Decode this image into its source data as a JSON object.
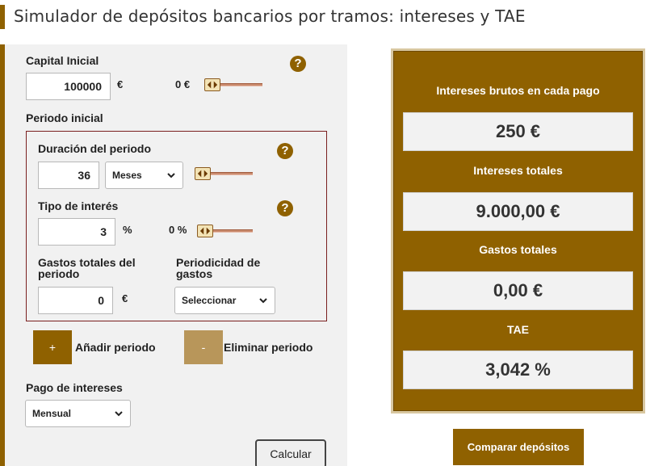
{
  "header": {
    "title": "Simulador de depósitos bancarios por tramos: intereses y TAE"
  },
  "capital": {
    "label": "Capital Inicial",
    "value": "100000",
    "unit": "€",
    "slider_min_label": "0 €",
    "slider_level": 0
  },
  "periodo": {
    "heading": "Periodo inicial",
    "duracion_label": "Duración del periodo",
    "duracion_value": "36",
    "duracion_unit_selected": "Meses",
    "duracion_slider_level": 0,
    "interes_label": "Tipo de interés",
    "interes_value": "3",
    "interes_unit": "%",
    "interes_slider_min_label": "0 %",
    "interes_slider_level": 0,
    "gastos_label": "Gastos totales del periodo",
    "gastos_value": "0",
    "gastos_unit": "€",
    "periodicidad_label": "Periodicidad de gastos",
    "periodicidad_selected": "Seleccionar"
  },
  "actions": {
    "add_symbol": "+",
    "add_label": "Añadir periodo",
    "remove_symbol": "-",
    "remove_label": "Eliminar periodo",
    "calcular": "Calcular",
    "comparar": "Comparar depósitos"
  },
  "pago": {
    "label": "Pago de intereses",
    "selected": "Mensual"
  },
  "help_symbol": "?",
  "results": {
    "intereses_pago_label": "Intereses brutos en cada pago",
    "intereses_pago_value": "250 €",
    "intereses_totales_label": "Intereses totales",
    "intereses_totales_value": "9.000,00 €",
    "gastos_totales_label": "Gastos totales",
    "gastos_totales_value": "0,00 €",
    "tae_label": "TAE",
    "tae_value": "3,042 %"
  },
  "colors": {
    "accent": "#8f6100",
    "accent_light": "#b8965a",
    "period_border": "#7a1f1f",
    "panel_bg": "#f1f1f1"
  },
  "icons": {
    "help": "question-circle-icon",
    "chevron": "chevron-down-icon",
    "slider_handle": "slider-handle-icon"
  }
}
